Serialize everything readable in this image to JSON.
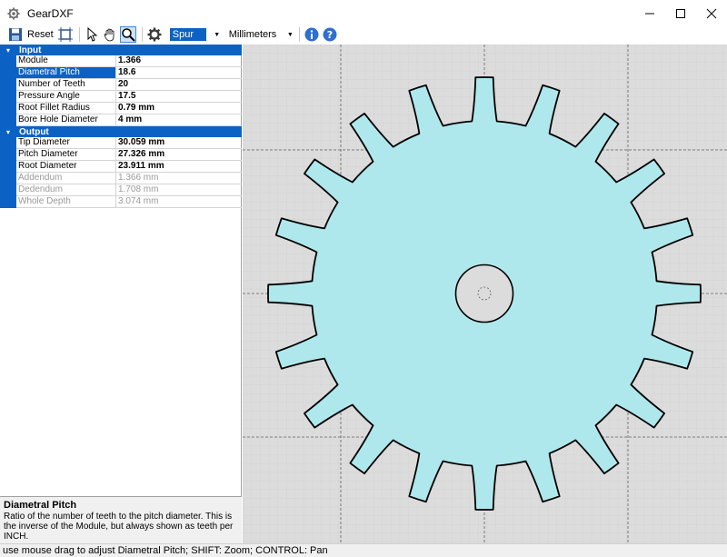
{
  "window": {
    "title": "GearDXF",
    "minimize_icon": "minimize-icon",
    "maximize_icon": "maximize-icon",
    "close_icon": "close-icon"
  },
  "toolbar": {
    "save_icon": "save-icon",
    "reset_label": "Reset",
    "gear_type": "Spur",
    "units": "Millimeters"
  },
  "properties": {
    "input": {
      "label": "Input",
      "rows": [
        {
          "name": "Module",
          "value": "1.366"
        },
        {
          "name": "Diametral Pitch",
          "value": "18.6"
        },
        {
          "name": "Number of Teeth",
          "value": "20"
        },
        {
          "name": "Pressure Angle",
          "value": "17.5"
        },
        {
          "name": "Root Fillet Radius",
          "value": "0.79 mm"
        },
        {
          "name": "Bore Hole Diameter",
          "value": "4 mm"
        }
      ]
    },
    "output": {
      "label": "Output",
      "rows": [
        {
          "name": "Tip Diameter",
          "value": "30.059 mm"
        },
        {
          "name": "Pitch Diameter",
          "value": "27.326 mm"
        },
        {
          "name": "Root Diameter",
          "value": "23.911 mm"
        },
        {
          "name": "Addendum",
          "value": "1.366 mm"
        },
        {
          "name": "Dedendum",
          "value": "1.708 mm"
        },
        {
          "name": "Whole Depth",
          "value": "3.074 mm"
        }
      ]
    }
  },
  "description": {
    "title": "Diametral Pitch",
    "text": "Ratio of the number of teeth to the pitch diameter. This is the inverse of the Module, but always shown as teeth per INCH."
  },
  "status": {
    "text": "use mouse drag to adjust Diametral Pitch; SHIFT: Zoom; CONTROL: Pan"
  },
  "colors": {
    "accent": "#0b62c4",
    "gear_fill": "#aee8ec",
    "canvas_bg": "#dcdcdc"
  },
  "gear": {
    "teeth": 20
  }
}
